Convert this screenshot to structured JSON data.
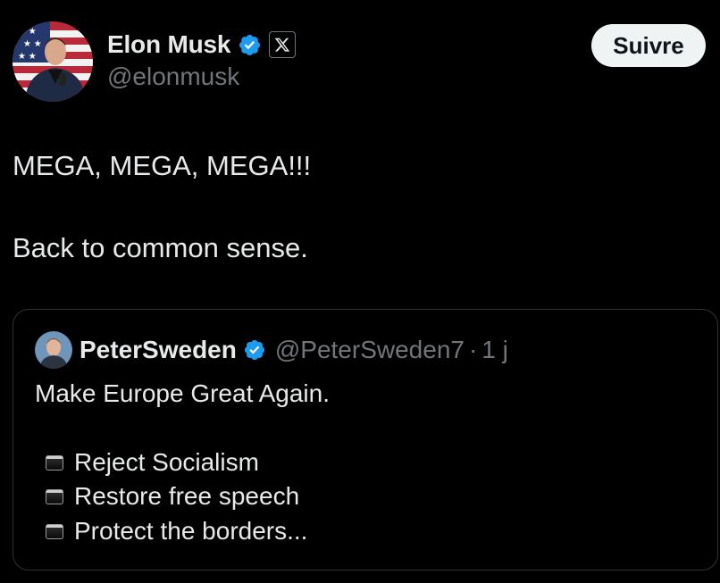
{
  "post": {
    "author": {
      "display_name": "Elon Musk",
      "handle": "@elonmusk",
      "verified": true,
      "affiliation_icon": "x-logo-icon"
    },
    "follow_button": "Suivre",
    "text_lines": [
      "MEGA, MEGA, MEGA!!!",
      "Back to common sense."
    ]
  },
  "quote": {
    "author": {
      "display_name": "PeterSweden",
      "handle": "@PeterSweden7",
      "verified": true
    },
    "separator": "·",
    "time": "1 j",
    "text": "Make Europe Great Again.",
    "bullets": [
      "Reject Socialism",
      "Restore free speech",
      "Protect the borders..."
    ],
    "bullet_icon": "black-square-icon"
  },
  "colors": {
    "background": "#000000",
    "text": "#e7e9ea",
    "secondary": "#71767b",
    "verified": "#1d9bf0",
    "border": "#2f3336",
    "button_bg": "#eff3f4"
  }
}
